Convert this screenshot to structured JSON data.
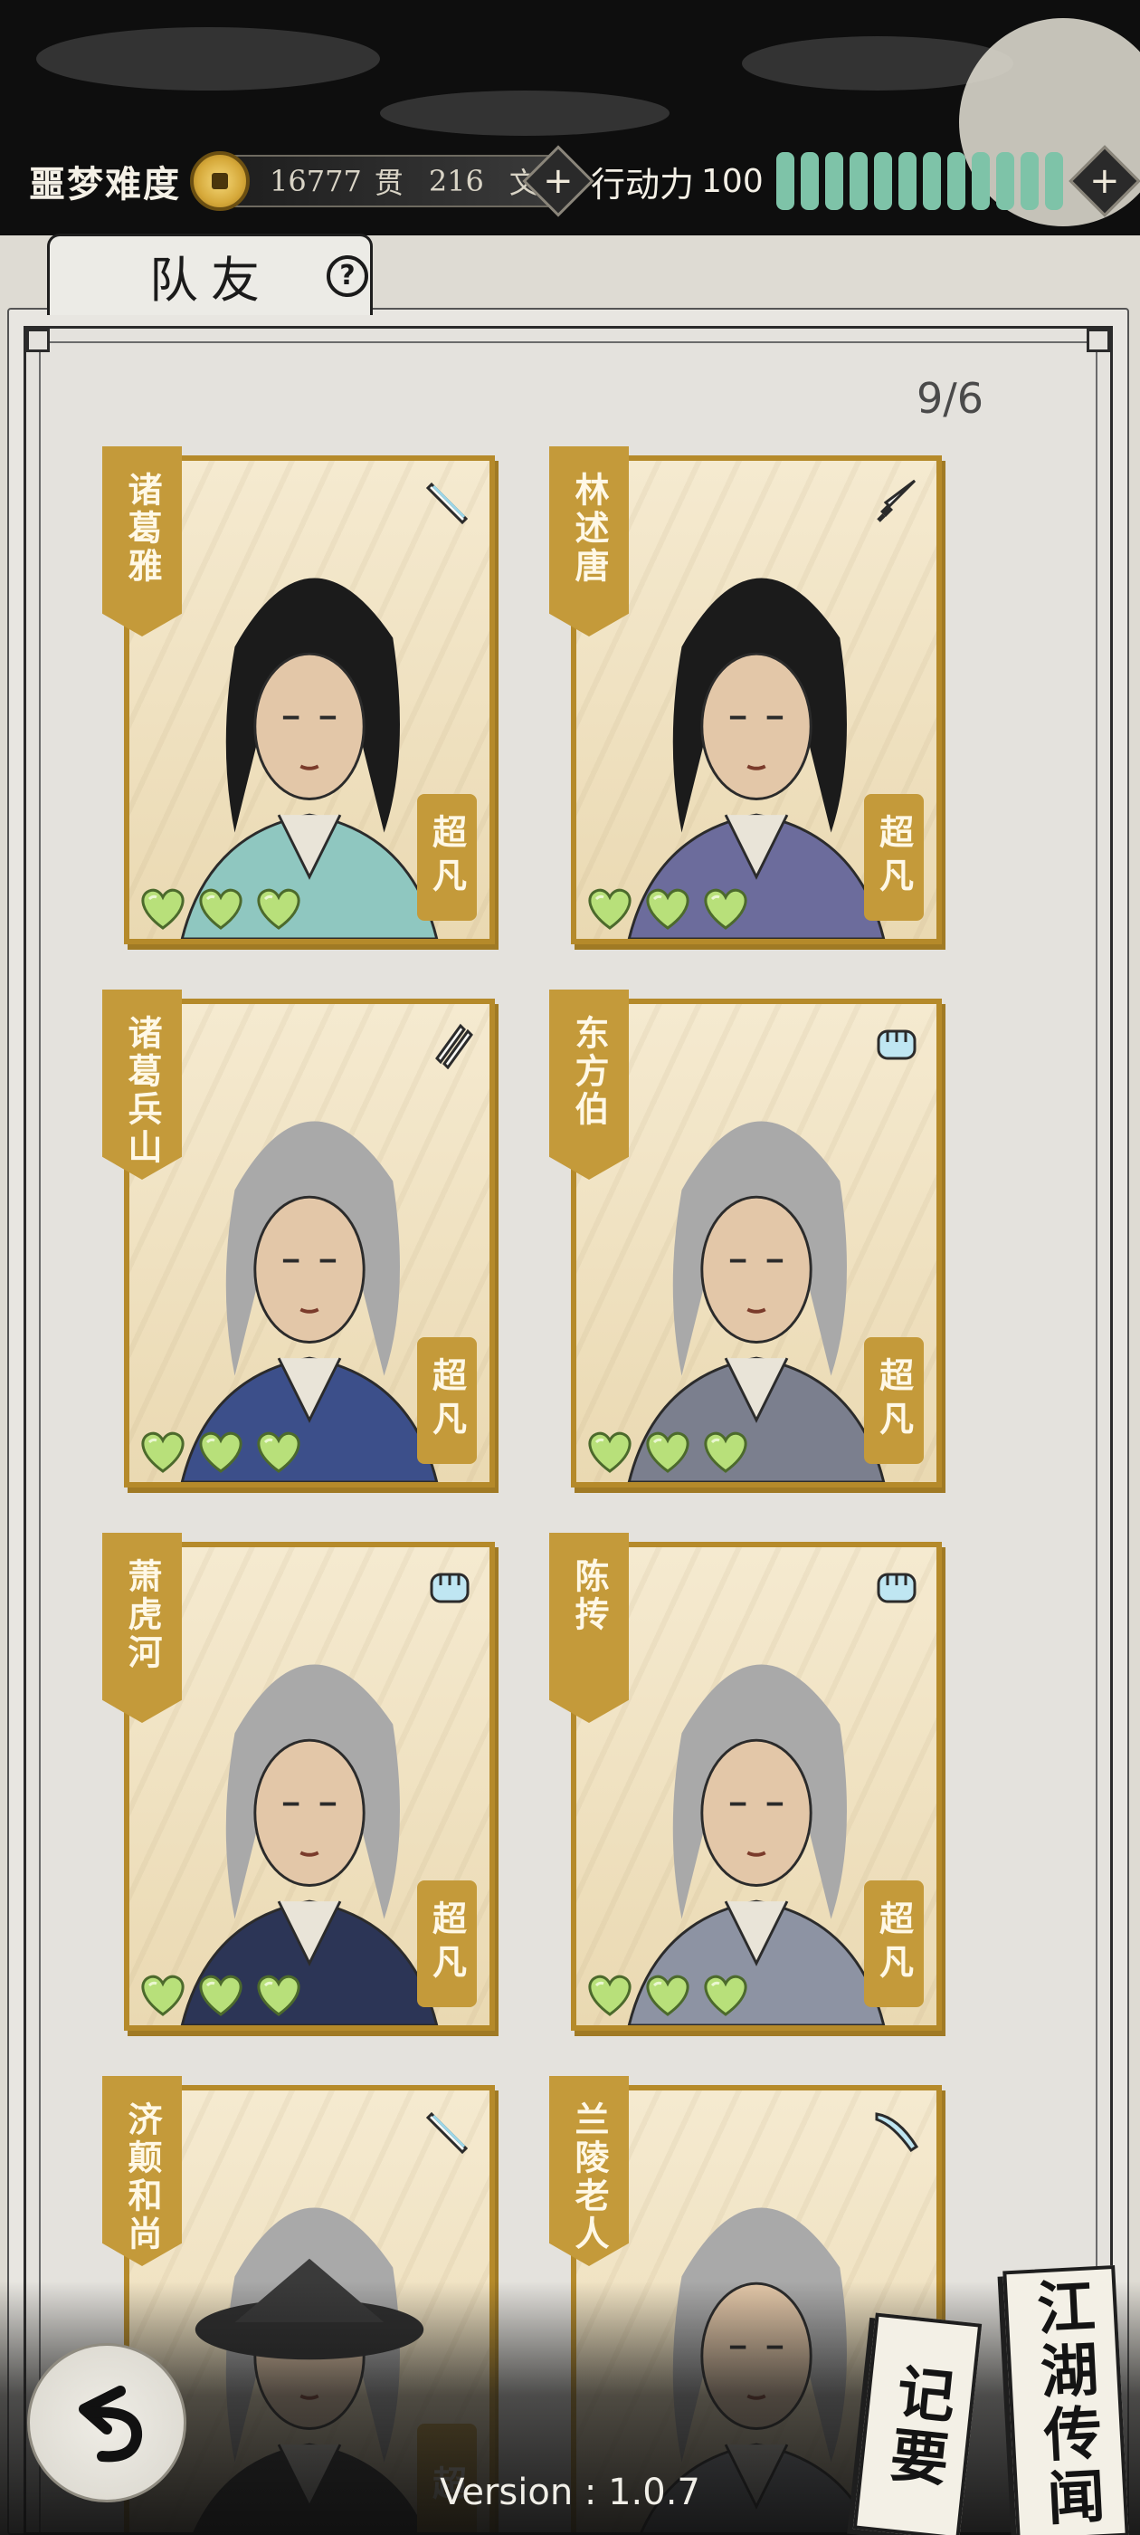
{
  "hud": {
    "difficulty": "噩梦难度",
    "money_guan": "16777",
    "money_guan_unit": "贯",
    "money_wen": "216",
    "money_wen_unit": "文",
    "action_label": "行动力",
    "action_value": "100",
    "action_segments": 12,
    "add_symbol": "+"
  },
  "header": {
    "title": "队友",
    "help_symbol": "?"
  },
  "party": {
    "count": "9/6",
    "members": [
      {
        "name": "诸葛雅",
        "rank": "超凡",
        "weapon": "sword-icon",
        "hearts": 3
      },
      {
        "name": "林述唐",
        "rank": "超凡",
        "weapon": "dagger-icon",
        "hearts": 3
      },
      {
        "name": "诸葛兵山",
        "rank": "超凡",
        "weapon": "twin-blades-icon",
        "hearts": 3
      },
      {
        "name": "东方伯",
        "rank": "超凡",
        "weapon": "fist-icon",
        "hearts": 3
      },
      {
        "name": "萧虎河",
        "rank": "超凡",
        "weapon": "fist-icon",
        "hearts": 3
      },
      {
        "name": "陈抟",
        "rank": "超凡",
        "weapon": "fist-icon",
        "hearts": 3
      },
      {
        "name": "济颠和尚",
        "rank": "超",
        "weapon": "sword-icon",
        "hearts": 0
      },
      {
        "name": "兰陵老人",
        "rank": "",
        "weapon": "broadsword-icon",
        "hearts": 0
      }
    ]
  },
  "footer": {
    "notes_label": "记要",
    "rumors_label": "江湖传闻",
    "version": "Version : 1.0.7"
  },
  "colors": {
    "card_gold": "#c49a3a",
    "heart_green": "#b8e07a",
    "action_green": "#7ec3a8"
  }
}
